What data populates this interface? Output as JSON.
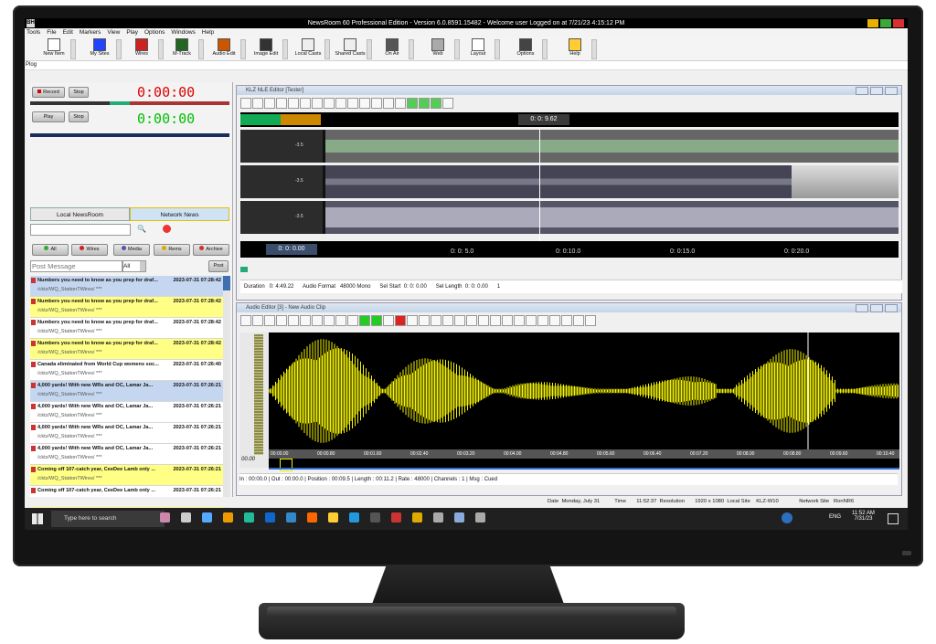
{
  "window": {
    "title": "NewsRoom 60 Professional Edition - Version 6.0.8591.15482 - Welcome user Logged on at 7/21/23 4:15:12 PM",
    "app_icon": "BH"
  },
  "menu": [
    "Tools",
    "File",
    "Edit",
    "Markers",
    "View",
    "Play",
    "Options",
    "Windows",
    "Help"
  ],
  "toolbar": [
    "New Item",
    "My Sites",
    "Wires",
    "M-Track",
    "Audio Edit",
    "Image Edit",
    "Local Casts",
    "Shared Casts",
    "On Air",
    "Web",
    "Layout",
    "Options",
    "Help"
  ],
  "plog": "Plog",
  "recorder": {
    "record": "Record",
    "stop": "Stop",
    "play": "Play",
    "stop2": "Stop",
    "rec_time": "0:00:00",
    "play_time": "0:00:00"
  },
  "news_tabs": [
    "Local NewsRoom",
    "Network News"
  ],
  "filters": [
    "All",
    "Wires",
    "Media",
    "Rems",
    "Archive"
  ],
  "post": {
    "placeholder": "Post Message",
    "scope": "All",
    "button": "Post"
  },
  "messages": [
    {
      "title": "Numbers you need to know as you prep for draf...",
      "time": "2023-07-31 07:28:42",
      "path": "/cktz/WQ_StationTWires/ ***",
      "style": "sel"
    },
    {
      "title": "Numbers you need to know as you prep for draf...",
      "time": "2023-07-31 07:28:42",
      "path": "/cktz/WQ_StationTWires/ ***",
      "style": "yel"
    },
    {
      "title": "Numbers you need to know as you prep for draf...",
      "time": "2023-07-31 07:28:42",
      "path": "/cktz/WQ_StationTWires/ ***",
      "style": ""
    },
    {
      "title": "Numbers you need to know as you prep for draf...",
      "time": "2023-07-31 07:28:42",
      "path": "/cktz/WQ_StationTWires/ ***",
      "style": "yel"
    },
    {
      "title": "Canada eliminated from World Cup womens soc...",
      "time": "2023-07-31 07:26:40",
      "path": "/cktz/WQ_StationTWires/ ***",
      "style": ""
    },
    {
      "title": "4,000 yards! With new WRs and OC, Lamar Ja...",
      "time": "2023-07-31 07:26:21",
      "path": "/cktz/WQ_StationTWires/ ***",
      "style": "sel"
    },
    {
      "title": "4,000 yards! With new WRs and OC, Lamar Ja...",
      "time": "2023-07-31 07:26:21",
      "path": "/cktz/WQ_StationTWires/ ***",
      "style": ""
    },
    {
      "title": "4,000 yards! With new WRs and OC, Lamar Ja...",
      "time": "2023-07-31 07:26:21",
      "path": "/cktz/WQ_StationTWires/ ***",
      "style": ""
    },
    {
      "title": "4,000 yards! With new WRs and OC, Lamar Ja...",
      "time": "2023-07-31 07:26:21",
      "path": "/cktz/WQ_StationTWires/ ***",
      "style": ""
    },
    {
      "title": "Coming off 107-catch year, CeeDee Lamb only ...",
      "time": "2023-07-31 07:26:21",
      "path": "/cktz/WQ_StationTWires/ ***",
      "style": "yel"
    },
    {
      "title": "Coming off 107-catch year, CeeDee Lamb only ...",
      "time": "2023-07-31 07:26:21",
      "path": "/cktz/WQ_StationTWires/ ***",
      "style": ""
    },
    {
      "title": "Coming off 107-catch year, CeeDee Lamb only ...",
      "time": "2023-07-31 07:26:21",
      "path": "/cktz/WQ_StationTWires/ ***",
      "style": "yel"
    },
    {
      "title": "Coming off 107-catch year, CeeDee Lamb only ...",
      "time": "2023-07-31 07:26:21",
      "path": "/cktz/WQ_StationTWires/ ***",
      "style": ""
    },
    {
      "title": "Frank Clark wants to help Broncos reignite Chie...",
      "time": "2023-07-31 07:26:21",
      "path": "/cktz/WQ_StationTWires/ ***",
      "style": "yel"
    },
    {
      "title": "Frank Clark wants to help Broncos reignite Chie...",
      "time": "2023-07-31 07:26:21",
      "path": "/cktz/WQ_StationTWires/ ***",
      "style": ""
    }
  ],
  "nle": {
    "title": "KLZ NLE Editor [Tester]",
    "position": "0: 0: 9.62",
    "start": "0: 0: 0.00",
    "ticks": [
      "0: 0: 5.0",
      "0: 0:10.0",
      "0: 0:15.0",
      "0: 0:20.0"
    ],
    "track_gain": "-3.5",
    "status": "Duration   0: 4:49.22      Audio Format   48000 Mono      Sel Start  0: 0: 0.00      Sel Length  0: 0: 0.00      1"
  },
  "audio_editor": {
    "title": "Audio Editor [3] - New Audio Clip",
    "time_ticks": [
      "00:00.00",
      "00:00.80",
      "00:01.60",
      "00:02.40",
      "00:03.20",
      "00:04.00",
      "00:04.80",
      "00:05.60",
      "00:06.40",
      "00:07.20",
      "00:08.00",
      "00:08.80",
      "00:09.60",
      "00:10.40"
    ],
    "counter": "00.00",
    "status": "In : 00:00.0 | Out : 00:00.0 | Position : 00:09.5 | Length : 00:11.2 | Rate : 48000 | Channels : 1 | Msg : Cued"
  },
  "app_status": "Date  Monday, July 31          Time       11:52:37  Resolution       1920 x 1080  Local Site    KLZ-W10              Network Site   RonNR6",
  "taskbar": {
    "search": "Type here to search",
    "lang": "ENG",
    "time": "11:52 AM",
    "date": "7/31/23"
  },
  "colors": {
    "rec_timer": "#e00000",
    "play_timer": "#00c000",
    "wave": "#f5f500",
    "yellow_row": "#ffff86"
  }
}
